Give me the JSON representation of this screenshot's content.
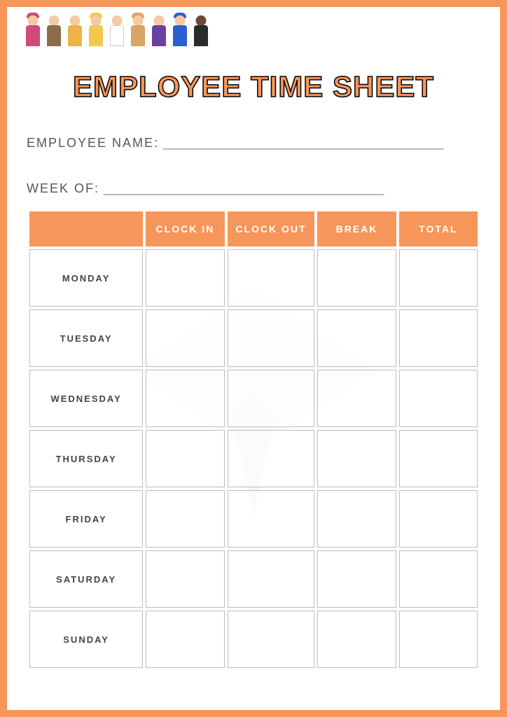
{
  "title": "EMPLOYEE TIME SHEET",
  "fields": {
    "name_label": "EMPLOYEE NAME:",
    "name_value": "",
    "week_label": "WEEK OF:",
    "week_value": ""
  },
  "underline": "________________________________________",
  "underline2": "________________________________________",
  "table": {
    "headers": {
      "blank": "",
      "clock_in": "CLOCK IN",
      "clock_out": "CLOCK OUT",
      "break": "BREAK",
      "total": "TOTAL"
    },
    "rows": [
      {
        "day": "MONDAY",
        "clock_in": "",
        "clock_out": "",
        "break": "",
        "total": ""
      },
      {
        "day": "TUESDAY",
        "clock_in": "",
        "clock_out": "",
        "break": "",
        "total": ""
      },
      {
        "day": "WEDNESDAY",
        "clock_in": "",
        "clock_out": "",
        "break": "",
        "total": ""
      },
      {
        "day": "THURSDAY",
        "clock_in": "",
        "clock_out": "",
        "break": "",
        "total": ""
      },
      {
        "day": "FRIDAY",
        "clock_in": "",
        "clock_out": "",
        "break": "",
        "total": ""
      },
      {
        "day": "SATURDAY",
        "clock_in": "",
        "clock_out": "",
        "break": "",
        "total": ""
      },
      {
        "day": "SUNDAY",
        "clock_in": "",
        "clock_out": "",
        "break": "",
        "total": ""
      }
    ]
  },
  "people": [
    {
      "head": "#f5c9a4",
      "body": "#d14a7a",
      "hat": "#d14a7a"
    },
    {
      "head": "#f5c9a4",
      "body": "#8a6d4a",
      "hat": null
    },
    {
      "head": "#f5c9a4",
      "body": "#efb24a",
      "hat": null
    },
    {
      "head": "#f5c9a4",
      "body": "#f2c94c",
      "hat": "#f2c94c"
    },
    {
      "head": "#f5c9a4",
      "body": "#ffffff",
      "hat": null
    },
    {
      "head": "#f5c9a4",
      "body": "#d9a566",
      "hat": "#d9a566"
    },
    {
      "head": "#f5c9a4",
      "body": "#6b3fa0",
      "hat": null
    },
    {
      "head": "#f5c9a4",
      "body": "#2d5fcf",
      "hat": "#2d5fcf"
    },
    {
      "head": "#6b4a33",
      "body": "#2b2b2b",
      "hat": null
    }
  ]
}
